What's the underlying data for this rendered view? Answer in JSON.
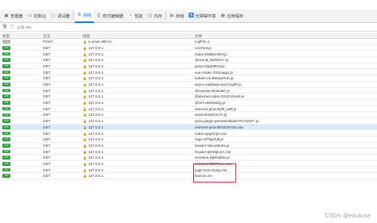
{
  "tabs": [
    {
      "label": "查看器",
      "icon": "inspector-icon",
      "glyph": "▣"
    },
    {
      "label": "控制台",
      "icon": "console-icon",
      "glyph": "▭"
    },
    {
      "label": "调试器",
      "icon": "debugger-icon",
      "glyph": "▢"
    },
    {
      "label": "网络",
      "icon": "network-icon",
      "glyph": "⇅",
      "active": true
    },
    {
      "label": "样式编辑器",
      "icon": "style-editor-icon",
      "glyph": "{}"
    },
    {
      "label": "性能",
      "icon": "performance-icon",
      "glyph": "◔"
    },
    {
      "label": "内存",
      "icon": "memory-icon",
      "glyph": "◫"
    },
    {
      "label": "存储",
      "icon": "storage-icon",
      "glyph": "▤"
    },
    {
      "label": "无障碍环境",
      "icon": "accessibility-icon",
      "glyph": "♿"
    },
    {
      "label": "应用程序",
      "icon": "application-icon",
      "glyph": "▦"
    }
  ],
  "filter": {
    "icon": "trash-icon",
    "filter_icon": "filter-icon",
    "placeholder": "过滤 URL"
  },
  "columns": {
    "status": "状态",
    "method": "方法",
    "domain": "域名",
    "file": "文件"
  },
  "rows": [
    {
      "status": "",
      "method": "POST",
      "domain": "s.union.360.cn",
      "file": "s.gif?h=1",
      "pre": true
    },
    {
      "status": "200",
      "method": "GET",
      "domain": "127.0.0.1",
      "file": "iconfont.js"
    },
    {
      "status": "200",
      "method": "GET",
      "domain": "127.0.0.1",
      "file": "index-DMb9VW0r.js"
    },
    {
      "status": "200",
      "method": "GET",
      "domain": "127.0.0.1",
      "file": "@vue-B_BwlVaV7.js"
    },
    {
      "status": "200",
      "method": "GET",
      "domain": "127.0.0.1",
      "file": "pinia-Cbp6dRc8.js"
    },
    {
      "status": "200",
      "method": "GET",
      "domain": "127.0.0.1",
      "file": "vue-router-O3GuaqU.js"
    },
    {
      "status": "200",
      "method": "GET",
      "domain": "127.0.0.1",
      "file": "lodash-es-B6nw4TuK.js"
    },
    {
      "status": "200",
      "method": "GET",
      "domain": "127.0.0.1",
      "file": "async-validator-qA4CeybP.js"
    },
    {
      "status": "200",
      "method": "GET",
      "domain": "127.0.0.1",
      "file": "@vueuse-Dnssakf-.js"
    },
    {
      "status": "200",
      "method": "GET",
      "domain": "127.0.0.1",
      "file": "@element-plus-DX22VmUE.js"
    },
    {
      "status": "200",
      "method": "GET",
      "domain": "127.0.0.1",
      "file": "@ctrl-v5Whd2Qj.js"
    },
    {
      "status": "200",
      "method": "GET",
      "domain": "127.0.0.1",
      "file": "element-plus-B2f0_u8P.js"
    },
    {
      "status": "200",
      "method": "GET",
      "domain": "127.0.0.1",
      "file": "axios-B4u9mvYG.js"
    },
    {
      "status": "200",
      "method": "GET",
      "domain": "127.0.0.1",
      "file": "pinia-plugin-persistedstate-RV7uh3T-.js"
    },
    {
      "status": "200",
      "method": "GET",
      "domain": "127.0.0.1",
      "file": "element-plus-BhOO3YDw.css",
      "selected": true
    },
    {
      "status": "200",
      "method": "GET",
      "domain": "127.0.0.1",
      "file": "index-apq4Kiyn.css"
    },
    {
      "status": "200",
      "method": "GET",
      "domain": "127.0.0.1",
      "file": "login-DT9guhdl.js"
    },
    {
      "status": "200",
      "method": "GET",
      "domain": "127.0.0.1",
      "file": "header-Muuo9mKv.js"
    },
    {
      "status": "200",
      "method": "GET",
      "domain": "127.0.0.1",
      "file": "header-BOWpnzA.css"
    },
    {
      "status": "200",
      "method": "GET",
      "domain": "127.0.0.1",
      "file": "versions-Dj9FaE6o.js"
    },
    {
      "status": "200",
      "method": "GET",
      "domain": "127.0.0.1",
      "file": "versions-DCPfvUe.css"
    },
    {
      "status": "200",
      "method": "GET",
      "domain": "127.0.0.1",
      "file": "login-Dno-Su4q.css"
    },
    {
      "status": "200",
      "method": "GET",
      "domain": "127.0.0.1",
      "file": "favicon.ico"
    }
  ],
  "watermark": "CSDN @excause",
  "colors": {
    "accent": "#1a73e8",
    "status_ok": "#2e9a3c",
    "highlight": "#e0202e",
    "selected_row": "#dce9fb"
  }
}
